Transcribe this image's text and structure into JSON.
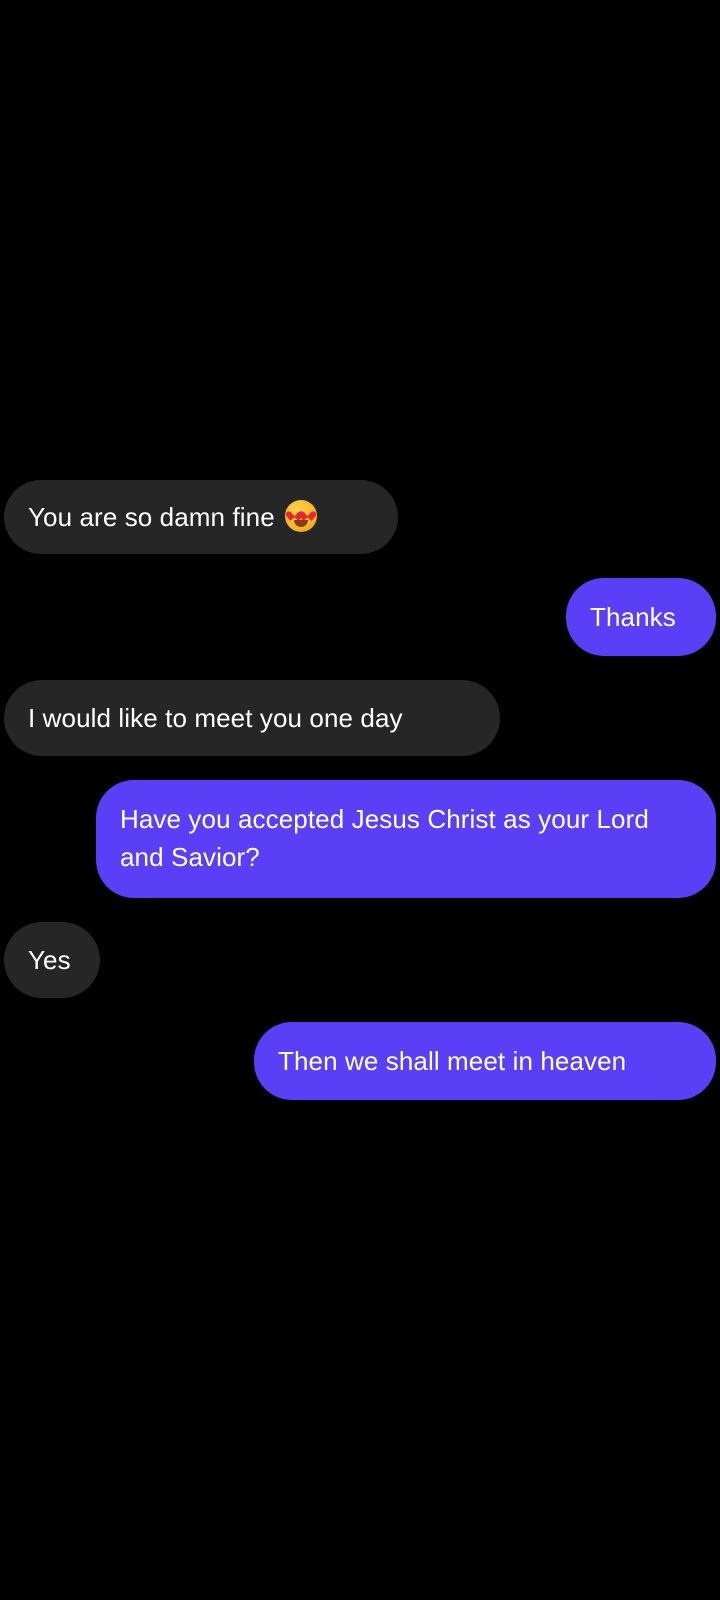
{
  "conversation": {
    "messages": [
      {
        "direction": "received",
        "text": "You are so damn fine",
        "emoji": "heart-eyes-emoji"
      },
      {
        "direction": "sent",
        "text": "Thanks"
      },
      {
        "direction": "received",
        "text": "I would like to meet you one day"
      },
      {
        "direction": "sent",
        "text": "Have you accepted Jesus Christ as your Lord and Savior?"
      },
      {
        "direction": "received",
        "text": "Yes"
      },
      {
        "direction": "sent",
        "text": "Then we shall meet in heaven"
      }
    ]
  },
  "colors": {
    "background": "#000000",
    "received_bubble": "#262626",
    "sent_bubble": "#5b3ff6",
    "text": "#ffffff"
  }
}
